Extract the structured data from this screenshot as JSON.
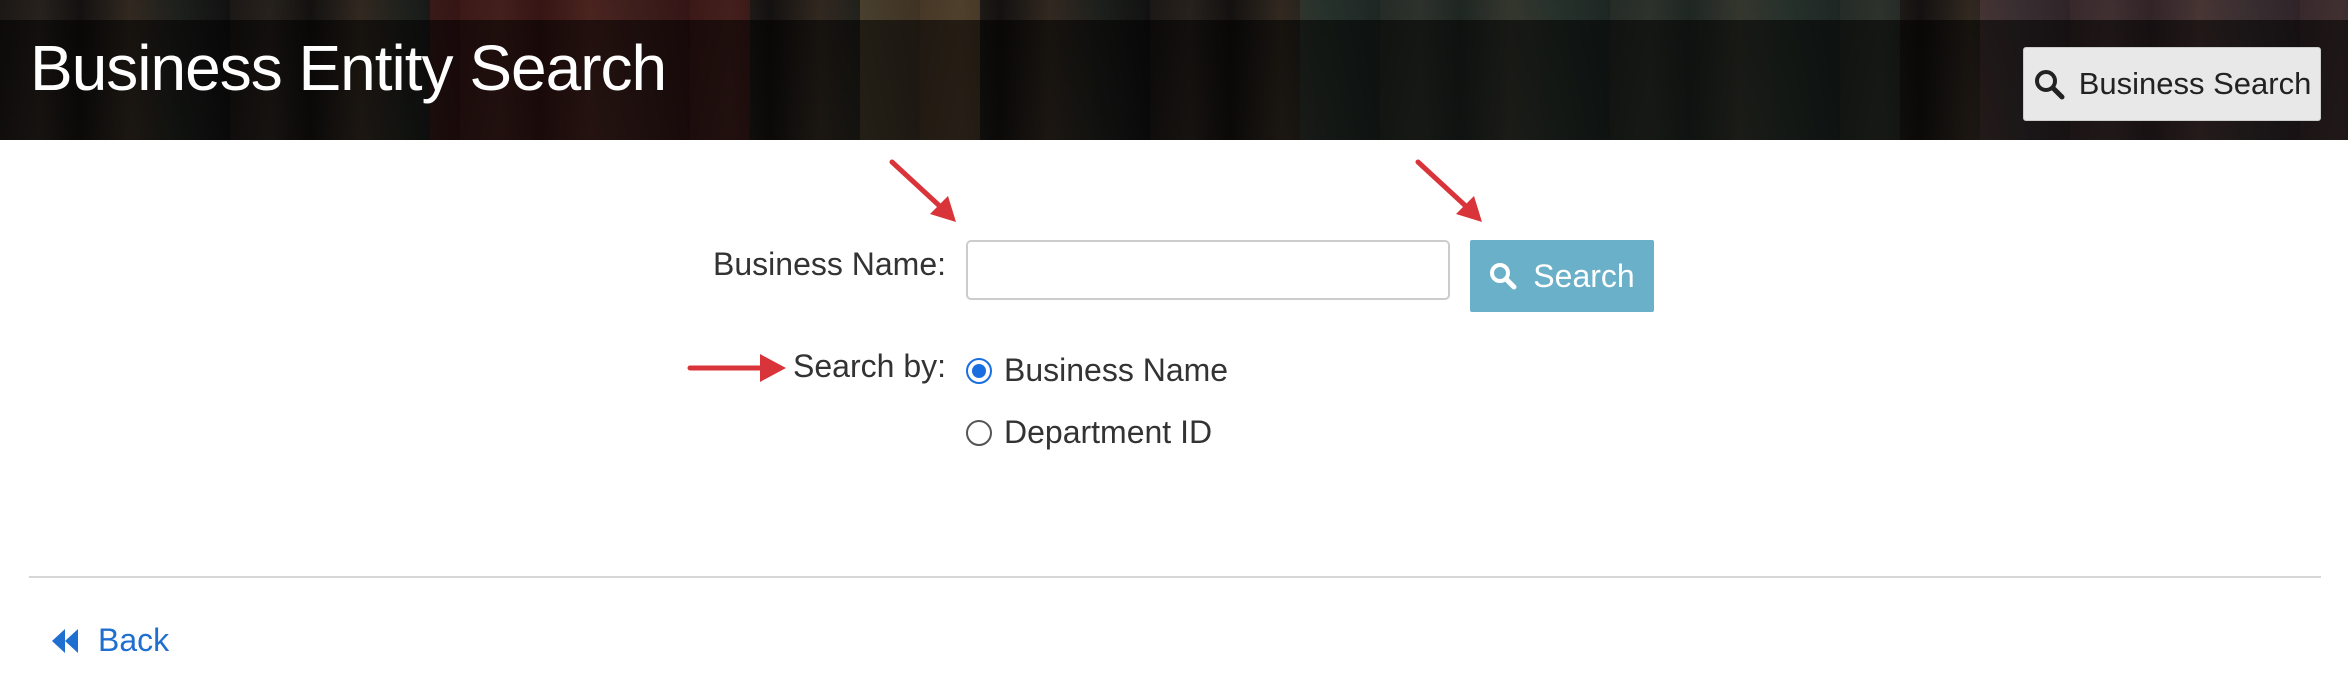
{
  "header": {
    "title": "Business Entity Search",
    "nav_button_label": "Business Search"
  },
  "form": {
    "business_name_label": "Business Name:",
    "business_name_value": "",
    "business_name_placeholder": "",
    "search_button_label": "Search",
    "search_by_label": "Search by:",
    "search_by_options": [
      {
        "label": "Business Name",
        "selected": true
      },
      {
        "label": "Department ID",
        "selected": false
      }
    ]
  },
  "footer": {
    "back_label": "Back"
  },
  "colors": {
    "search_button": "#6bb0c9",
    "link": "#1f6fd0",
    "radio_selected": "#1a6fe0",
    "annotation_arrow": "#d9343a"
  },
  "icons": {
    "nav_button": "search-icon",
    "search_button": "search-icon",
    "back": "double-chevron-left-icon",
    "annotations": "red-arrow-icon"
  }
}
